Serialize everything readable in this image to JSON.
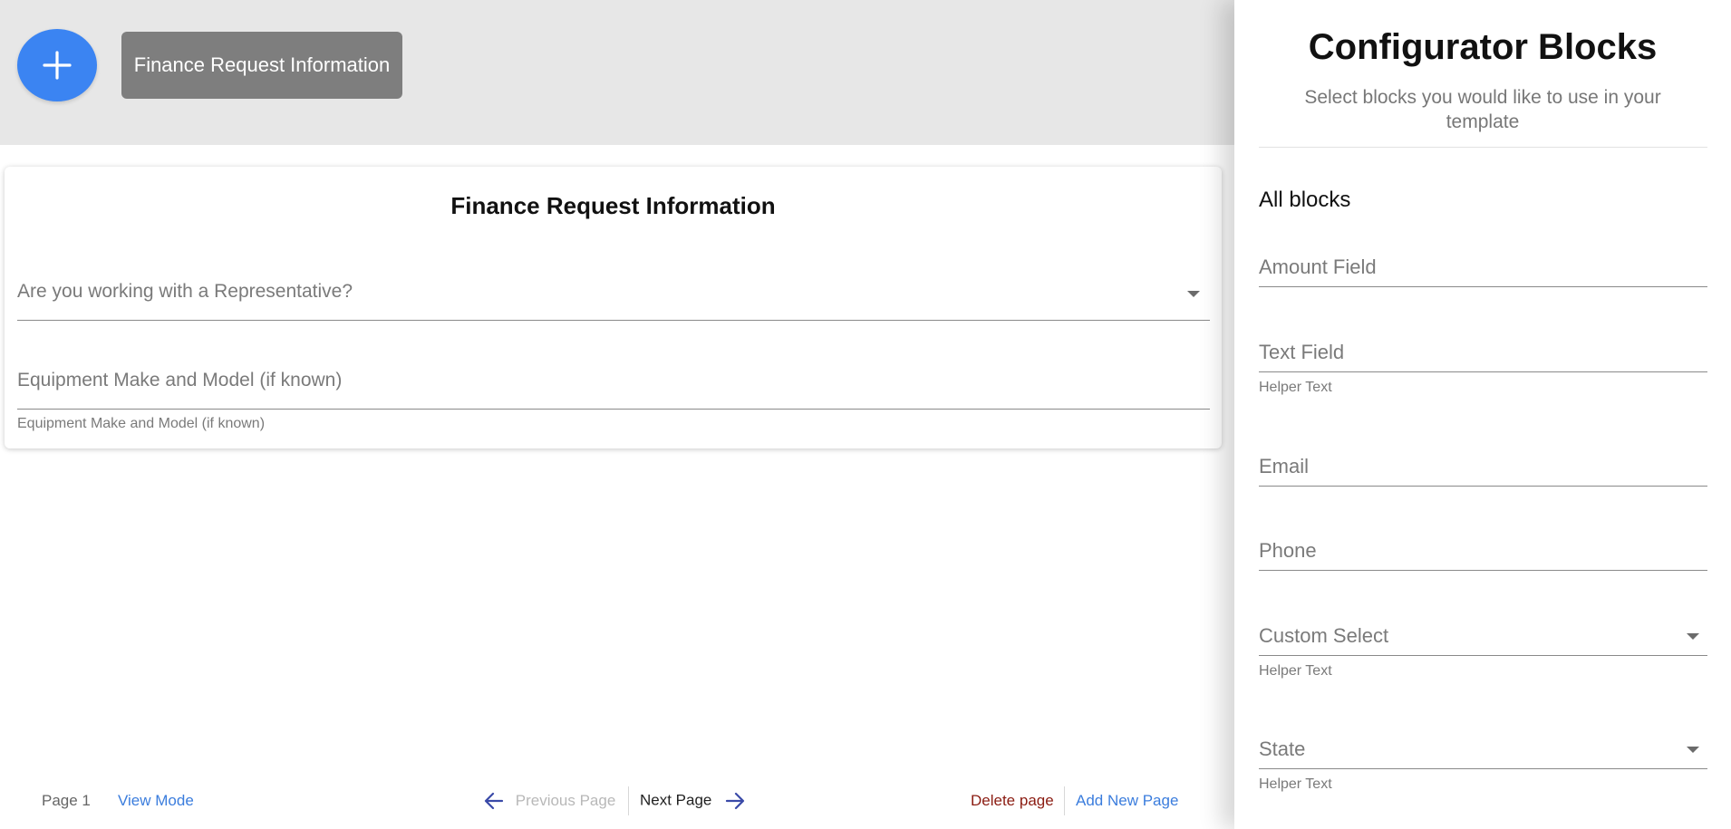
{
  "toolbar": {
    "add_label": "+",
    "page_chip": "Finance Request Information"
  },
  "form": {
    "title": "Finance Request Information",
    "fields": [
      {
        "label": "Are you working with a Representative?",
        "type": "select"
      },
      {
        "label": "Equipment Make and Model (if known)",
        "helper": "Equipment Make and Model (if known)",
        "type": "text"
      }
    ]
  },
  "footer": {
    "page_label": "Page 1",
    "view_mode": "View Mode",
    "previous_page": "Previous Page",
    "next_page": "Next Page",
    "delete_page": "Delete page",
    "add_new_page": "Add New Page"
  },
  "panel": {
    "title": "Configurator Blocks",
    "subtitle": "Select blocks you would like to use in your template",
    "group_heading": "All blocks",
    "blocks": [
      {
        "label": "Amount Field",
        "helper": "",
        "type": "text"
      },
      {
        "label": "Text Field",
        "helper": "Helper Text",
        "type": "text"
      },
      {
        "label": "Email",
        "helper": "",
        "type": "text"
      },
      {
        "label": "Phone",
        "helper": "",
        "type": "text"
      },
      {
        "label": "Custom Select",
        "helper": "Helper Text",
        "type": "select"
      },
      {
        "label": "State",
        "helper": "Helper Text",
        "type": "select"
      }
    ]
  },
  "colors": {
    "accent": "#3b84f2",
    "link": "#3b7ddd",
    "danger": "#8b1c12",
    "arrow": "#3a4aa8",
    "disabled": "#b8b8b8"
  },
  "icons": {
    "fab": "plus-icon",
    "prev": "arrow-left-icon",
    "next": "arrow-right-icon",
    "select": "caret-down-icon"
  }
}
